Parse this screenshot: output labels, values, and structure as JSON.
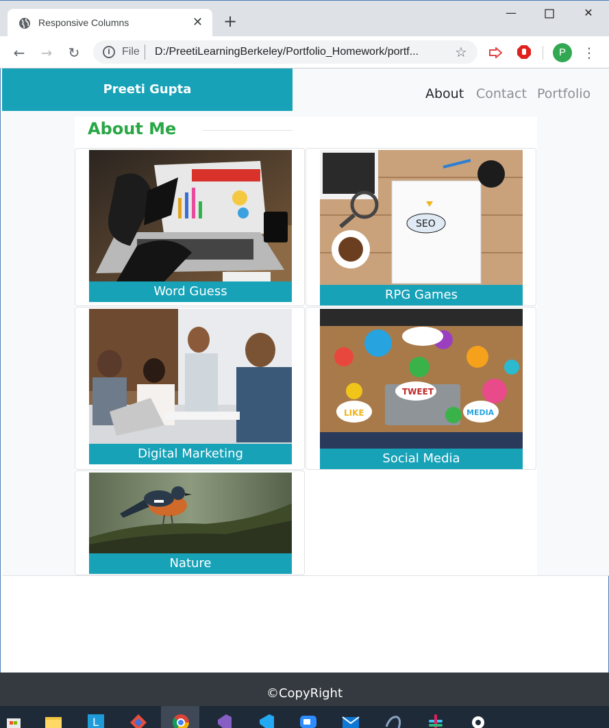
{
  "browser": {
    "tab_title": "Responsive Columns",
    "url_scheme_label": "File",
    "url": "D:/PreetiLearningBerkeley/Portfolio_Homework/portf...",
    "profile_initial": "P"
  },
  "navbar": {
    "brand": "Preeti Gupta",
    "links": [
      "About",
      "Contact",
      "Portfolio"
    ]
  },
  "main": {
    "heading": "About Me",
    "cards": [
      {
        "caption": "Word Guess",
        "image": "laptop-reputation-chart-photo"
      },
      {
        "caption": "RPG Games",
        "image": "seo-notebook-desk-photo"
      },
      {
        "caption": "Digital Marketing",
        "image": "team-meeting-photo"
      },
      {
        "caption": "Social Media",
        "image": "social-media-icons-table-photo"
      },
      {
        "caption": "Nature",
        "image": "bird-on-branch-photo"
      }
    ]
  },
  "footer": {
    "text": "©CopyRight"
  },
  "colors": {
    "brand_bg": "#17a2b8",
    "heading": "#28a745",
    "footer_bg": "#343a40"
  }
}
